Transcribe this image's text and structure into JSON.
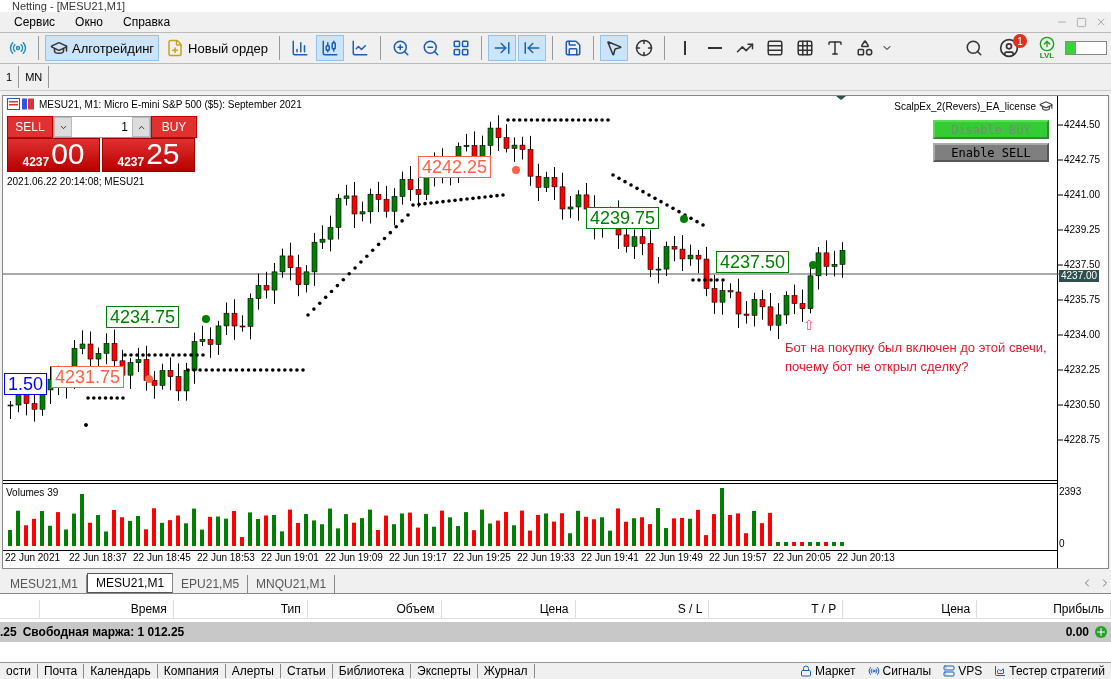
{
  "window": {
    "title": "Netting - [MESU21,M1]"
  },
  "menu": [
    "Сервис",
    "Окно",
    "Справка"
  ],
  "toolbar": [
    {
      "kind": "signals",
      "selected": false
    },
    {
      "kind": "separator"
    },
    {
      "kind": "algo",
      "label": "Алготрейдинг",
      "selected": true
    },
    {
      "kind": "order",
      "label": "Новый ордер",
      "selected": false
    },
    {
      "kind": "separator"
    },
    {
      "kind": "bars",
      "selected": false
    },
    {
      "kind": "candles",
      "selected": true
    },
    {
      "kind": "line",
      "selected": false
    },
    {
      "kind": "separator"
    },
    {
      "kind": "zoomin",
      "selected": false
    },
    {
      "kind": "zoomout",
      "selected": false
    },
    {
      "kind": "tile",
      "selected": false
    },
    {
      "kind": "separator"
    },
    {
      "kind": "autoscroll",
      "selected": true
    },
    {
      "kind": "shift",
      "selected": true
    },
    {
      "kind": "separator"
    },
    {
      "kind": "template",
      "selected": false
    },
    {
      "kind": "separator"
    },
    {
      "kind": "cursor",
      "selected": true
    },
    {
      "kind": "crosshair",
      "selected": false
    },
    {
      "kind": "separator"
    },
    {
      "kind": "vline",
      "selected": false
    },
    {
      "kind": "hline",
      "selected": false
    },
    {
      "kind": "trend",
      "selected": false
    },
    {
      "kind": "fibo",
      "selected": false
    },
    {
      "kind": "grid",
      "selected": false
    },
    {
      "kind": "text",
      "selected": false
    },
    {
      "kind": "arrows",
      "selected": false
    }
  ],
  "toolbar_right": {
    "notifications": "1",
    "level_label": "LVL",
    "meter": {
      "level": 0.25
    }
  },
  "timeframes": [
    {
      "label": "1",
      "selected": false
    },
    {
      "label": "MN",
      "selected": false
    }
  ],
  "chart": {
    "header": "MESU21, M1:  Micro E-mini S&P 500 ($5): September 2021",
    "trade_panel": {
      "sell": "SELL",
      "buy": "BUY",
      "volume": "1",
      "bid_main": "4237",
      "bid_pips": "00",
      "ask_main": "4237",
      "ask_pips": "25"
    },
    "timestamp": "2021.06.22 20:14:08; MESU21",
    "expert": "ScalpEx_2(Revers)_EA_license",
    "ea_buttons": [
      {
        "label": "Disable BUY",
        "on": true
      },
      {
        "label": "Enable SELL",
        "on": false
      }
    ],
    "price_labels": [
      {
        "text": "1.50",
        "color": "#0000ff"
      },
      {
        "text": "4231.75",
        "color": "#ff6347"
      },
      {
        "text": "4234.75",
        "color": "#008000"
      },
      {
        "text": "4242.25",
        "color": "#ff6347"
      },
      {
        "text": "4239.75",
        "color": "#008000"
      },
      {
        "text": "4237.50",
        "color": "#008000"
      }
    ],
    "comment_arrow": "⇧",
    "comment": [
      "Бот на покупку был включен до этой свечи,",
      "почему бот не открыл сделку?"
    ],
    "price_axis": [
      "4244.50",
      "4242.75",
      "4241.00",
      "4239.25",
      "4237.50",
      "4235.75",
      "4234.00",
      "4232.25",
      "4230.50",
      "4228.75"
    ],
    "current_price": "4237.00",
    "volumes": {
      "title": "Volumes 39",
      "max": "2393",
      "min": "0"
    },
    "time_axis": [
      "22 Jun 2021",
      "22 Jun 18:37",
      "22 Jun 18:45",
      "22 Jun 18:53",
      "22 Jun 19:01",
      "22 Jun 19:09",
      "22 Jun 19:17",
      "22 Jun 19:25",
      "22 Jun 19:33",
      "22 Jun 19:41",
      "22 Jun 19:49",
      "22 Jun 19:57",
      "22 Jun 20:05",
      "22 Jun 20:13"
    ]
  },
  "chart_tabs": [
    {
      "label": "MESU21,M1",
      "selected": false
    },
    {
      "label": "MESU21,M1",
      "selected": true
    },
    {
      "label": "EPU21,M5",
      "selected": false
    },
    {
      "label": "MNQU21,M1",
      "selected": false
    }
  ],
  "trade_table": {
    "columns": [
      "Время",
      "Тип",
      "Объем",
      "Цена",
      "S / L",
      "T / P",
      "Цена",
      "Прибыль"
    ],
    "summary": {
      "balance_tail": ".25",
      "free_margin": "Свободная маржа: 1 012.25",
      "profit": "0.00"
    }
  },
  "bottom_tabs": [
    "ости",
    "Почта",
    "Календарь",
    "Компания",
    "Алерты",
    "Статьи",
    "Библиотека",
    "Эксперты",
    "Журнал"
  ],
  "bottom_right": [
    "Маркет",
    "Сигналы",
    "VPS",
    "Тестер стратегий"
  ]
}
